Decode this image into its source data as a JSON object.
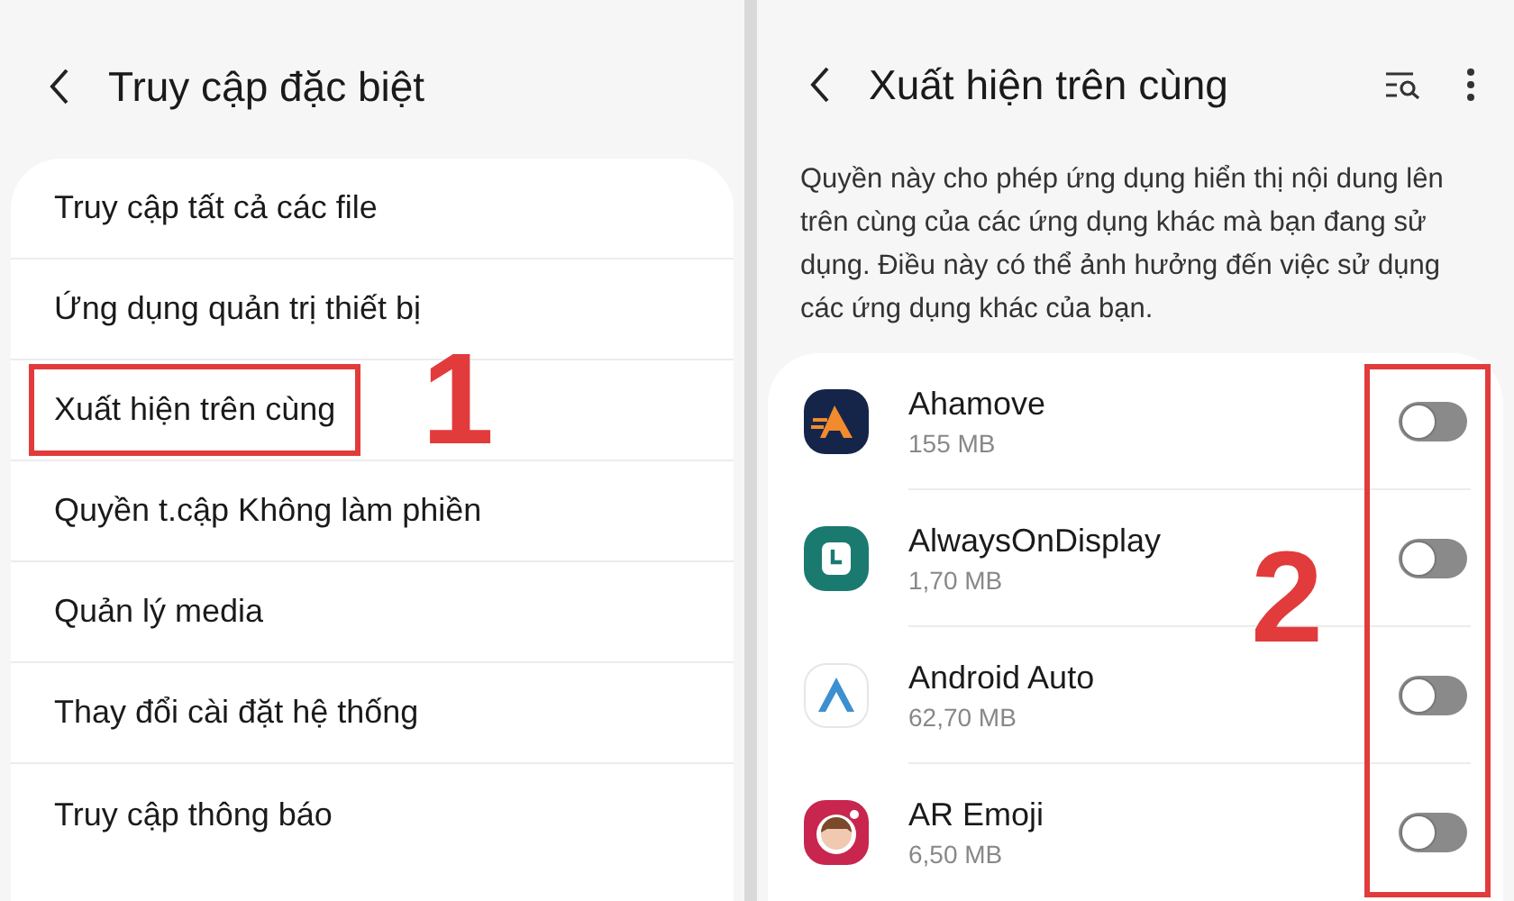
{
  "left": {
    "title": "Truy cập đặc biệt",
    "items": [
      {
        "label": "Truy cập tất cả các file",
        "highlighted": false
      },
      {
        "label": "Ứng dụng quản trị thiết bị",
        "highlighted": false
      },
      {
        "label": "Xuất hiện trên cùng",
        "highlighted": true
      },
      {
        "label": "Quyền t.cập Không làm phiền",
        "highlighted": false
      },
      {
        "label": "Quản lý media",
        "highlighted": false
      },
      {
        "label": "Thay đổi cài đặt hệ thống",
        "highlighted": false
      },
      {
        "label": "Truy cập thông báo",
        "highlighted": false
      }
    ],
    "step": "1"
  },
  "right": {
    "title": "Xuất hiện trên cùng",
    "description": "Quyền này cho phép ứng dụng hiển thị nội dung lên trên cùng của các ứng dụng khác mà bạn đang sử dụng. Điều này có thể ảnh hưởng đến việc sử dụng các ứng dụng khác của bạn.",
    "apps": [
      {
        "name": "Ahamove",
        "size": "155 MB",
        "on": false
      },
      {
        "name": "AlwaysOnDisplay",
        "size": "1,70 MB",
        "on": false
      },
      {
        "name": "Android Auto",
        "size": "62,70 MB",
        "on": false
      },
      {
        "name": "AR Emoji",
        "size": "6,50 MB",
        "on": false
      }
    ],
    "step": "2"
  }
}
